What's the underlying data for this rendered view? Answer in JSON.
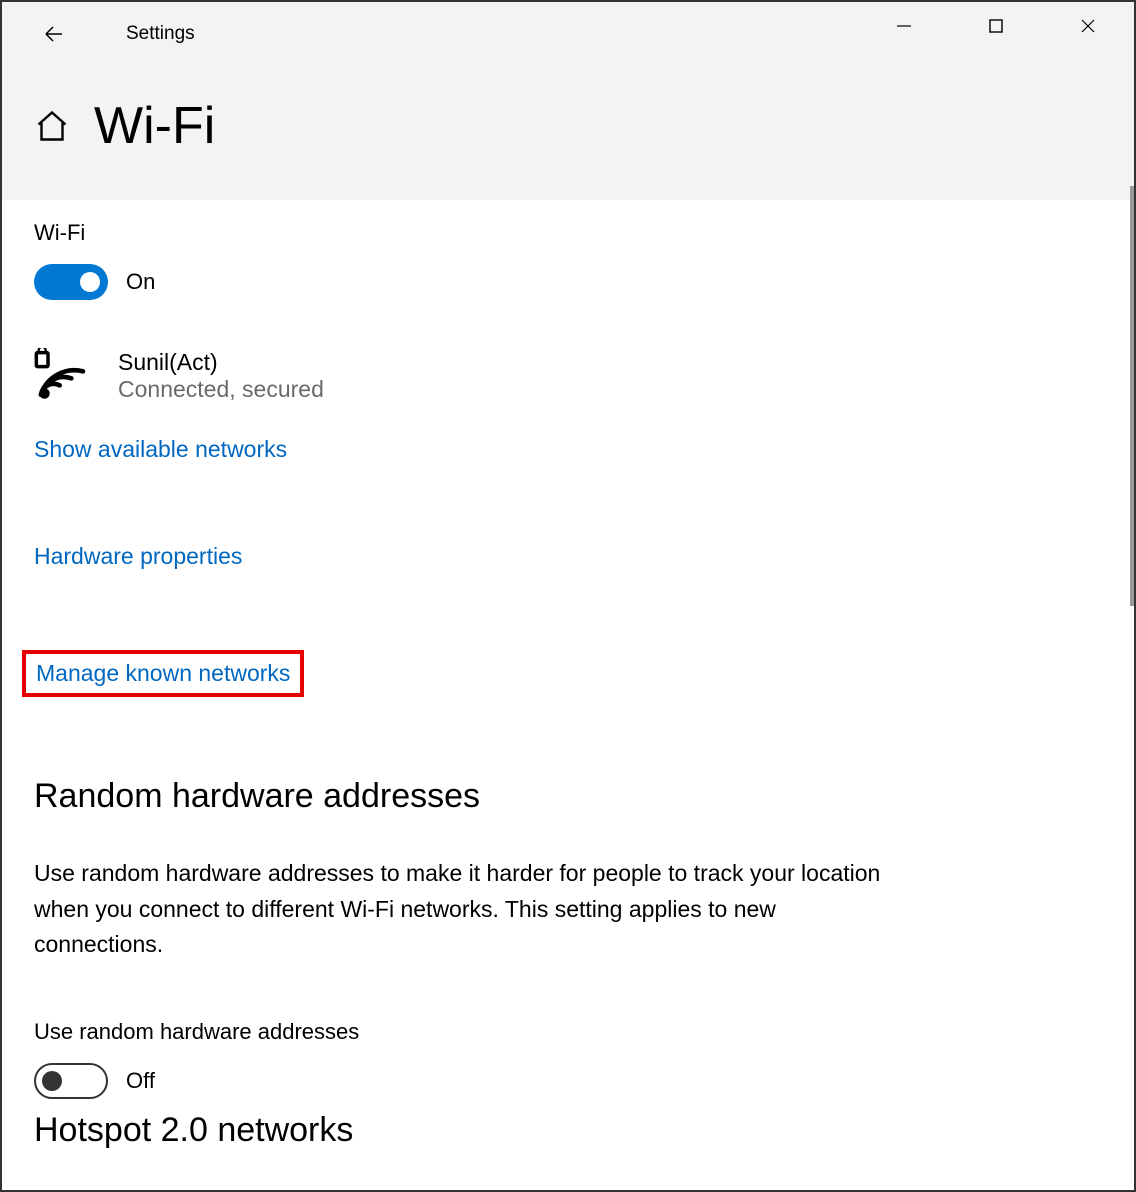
{
  "window": {
    "title": "Settings"
  },
  "header": {
    "page_title": "Wi-Fi"
  },
  "wifi": {
    "section_label": "Wi-Fi",
    "toggle_state": "On",
    "network_name": "Sunil(Act)",
    "network_status": "Connected, secured"
  },
  "links": {
    "show_available": "Show available networks",
    "hardware_properties": "Hardware properties",
    "manage_known": "Manage known networks"
  },
  "random_hw": {
    "heading": "Random hardware addresses",
    "description": "Use random hardware addresses to make it harder for people to track your location when you connect to different Wi-Fi networks. This setting applies to new connections.",
    "toggle_label": "Use random hardware addresses",
    "toggle_state": "Off"
  },
  "next_section": {
    "heading_cutoff": "Hotspot 2.0 networks"
  }
}
